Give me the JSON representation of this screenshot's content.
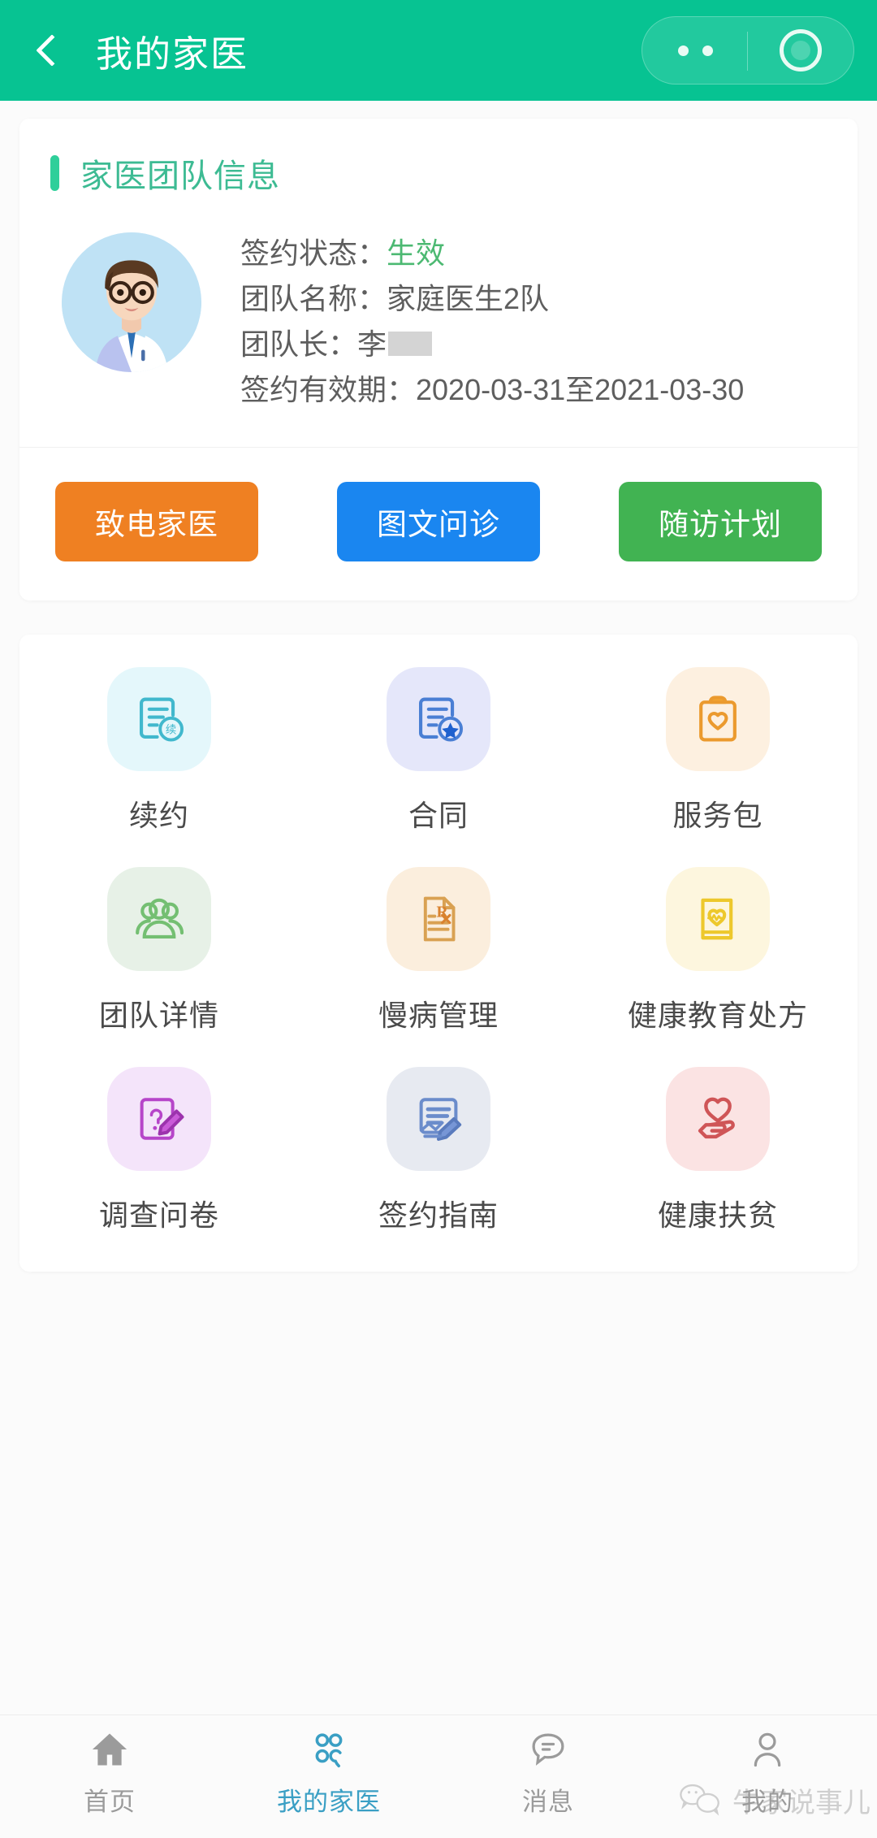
{
  "header": {
    "title": "我的家医",
    "back_icon": "chevron-left-icon",
    "capsule": {
      "more_icon": "ellipsis-icon",
      "close_icon": "target-circle-icon"
    },
    "bg_color": "#07c392"
  },
  "team_card": {
    "section_title": "家医团队信息",
    "accent_color": "#2fcf9a",
    "avatar_alt": "doctor-avatar",
    "rows": [
      {
        "label": "签约状态：",
        "value": "生效",
        "highlight": true
      },
      {
        "label": "团队名称：",
        "value": "家庭医生2队",
        "highlight": false
      },
      {
        "label": "团队长：",
        "value": "李",
        "redacted": true,
        "highlight": false
      },
      {
        "label": "签约有效期：",
        "value": "2020-03-31至2021-03-30",
        "highlight": false
      }
    ],
    "status_color": "#4cb972",
    "buttons": [
      {
        "label": "致电家医",
        "color": "#ef8022",
        "name": "call-doctor-button"
      },
      {
        "label": "图文问诊",
        "color": "#1a86f0",
        "name": "text-consult-button"
      },
      {
        "label": "随访计划",
        "color": "#41b352",
        "name": "followup-plan-button"
      }
    ]
  },
  "grid": {
    "items": [
      {
        "label": "续约",
        "icon": "renew-document-icon",
        "tile_bg": "#e4f7fb",
        "stroke": "#41b8cd"
      },
      {
        "label": "合同",
        "icon": "contract-star-icon",
        "tile_bg": "#e5e7fa",
        "stroke": "#4a7fd4"
      },
      {
        "label": "服务包",
        "icon": "clipboard-heart-icon",
        "tile_bg": "#fdf0e0",
        "stroke": "#eb9a2e"
      },
      {
        "label": "团队详情",
        "icon": "team-people-icon",
        "tile_bg": "#e7f1e7",
        "stroke": "#74bf72"
      },
      {
        "label": "慢病管理",
        "icon": "prescription-rx-icon",
        "tile_bg": "#fbeedd",
        "stroke": "#d9a152"
      },
      {
        "label": "健康教育处方",
        "icon": "health-book-heart-icon",
        "tile_bg": "#fdf6de",
        "stroke": "#edc82c"
      },
      {
        "label": "调查问卷",
        "icon": "questionnaire-pencil-icon",
        "tile_bg": "#f4e4fa",
        "stroke": "#b645c9"
      },
      {
        "label": "签约指南",
        "icon": "signing-guide-icon",
        "tile_bg": "#e7eaf1",
        "stroke": "#6b8ccb"
      },
      {
        "label": "健康扶贫",
        "icon": "heart-in-hand-icon",
        "tile_bg": "#fbe3e3",
        "stroke": "#cf5557"
      }
    ]
  },
  "tabbar": {
    "items": [
      {
        "label": "首页",
        "icon": "home-icon",
        "active": false
      },
      {
        "label": "我的家医",
        "icon": "stethoscope-icon",
        "active": true
      },
      {
        "label": "消息",
        "icon": "message-icon",
        "active": false
      },
      {
        "label": "我的",
        "icon": "person-icon",
        "active": false
      }
    ],
    "active_color": "#3a9fc4",
    "inactive_color": "#9b9b9b"
  },
  "watermark": {
    "text": "牛家说事儿",
    "icon": "wechat-icon"
  }
}
